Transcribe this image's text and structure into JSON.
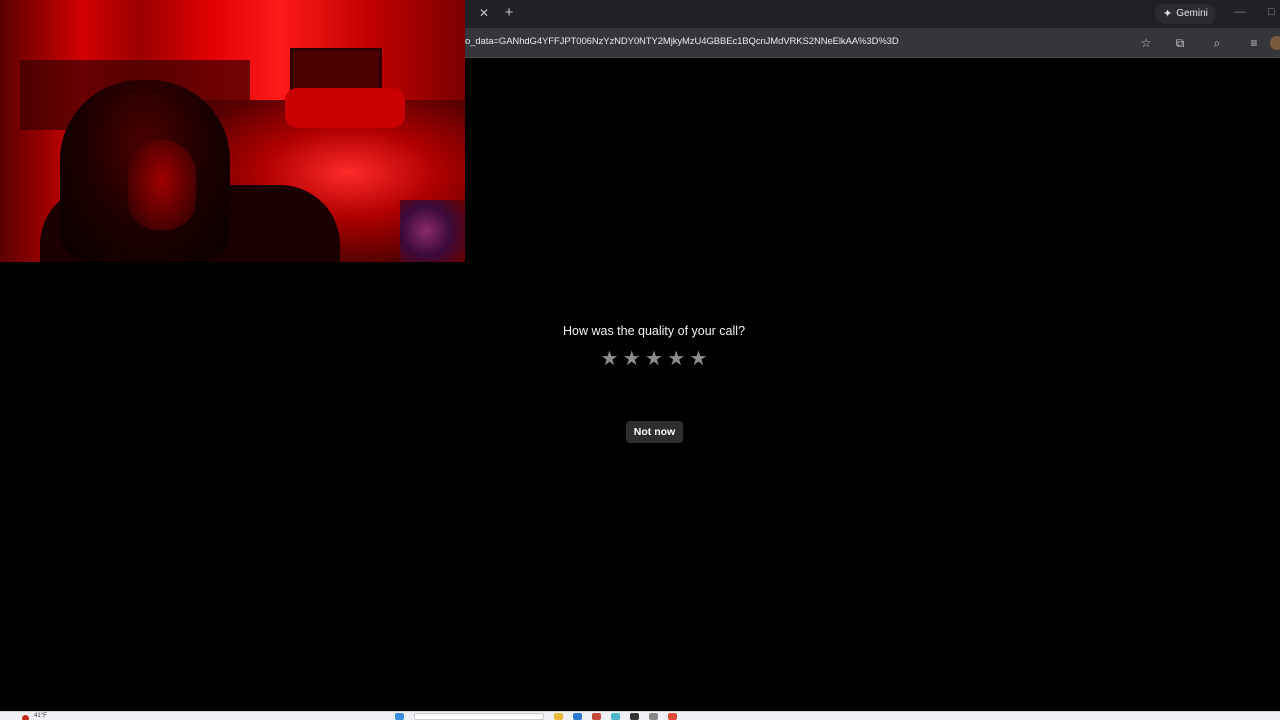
{
  "browser": {
    "tab_close_icon": "close-icon",
    "new_tab_label": "+",
    "gemini_label": "Gemini",
    "url": "o_data=GANhdG4YFFJPT006NzYzNDY0NTY2MjkyMzU4GBBEc1BQcnJMdVRKS2NNeElkAA%3D%3D"
  },
  "feedback": {
    "question": "How was the quality of your call?",
    "rating": 0,
    "max_rating": 5,
    "dismiss_label": "Not now"
  },
  "colors": {
    "page_background": "#000000",
    "star_inactive": "#8d8d8d",
    "button_background": "#2e2e2e"
  },
  "taskbar": {
    "weather_text": "41°F"
  }
}
